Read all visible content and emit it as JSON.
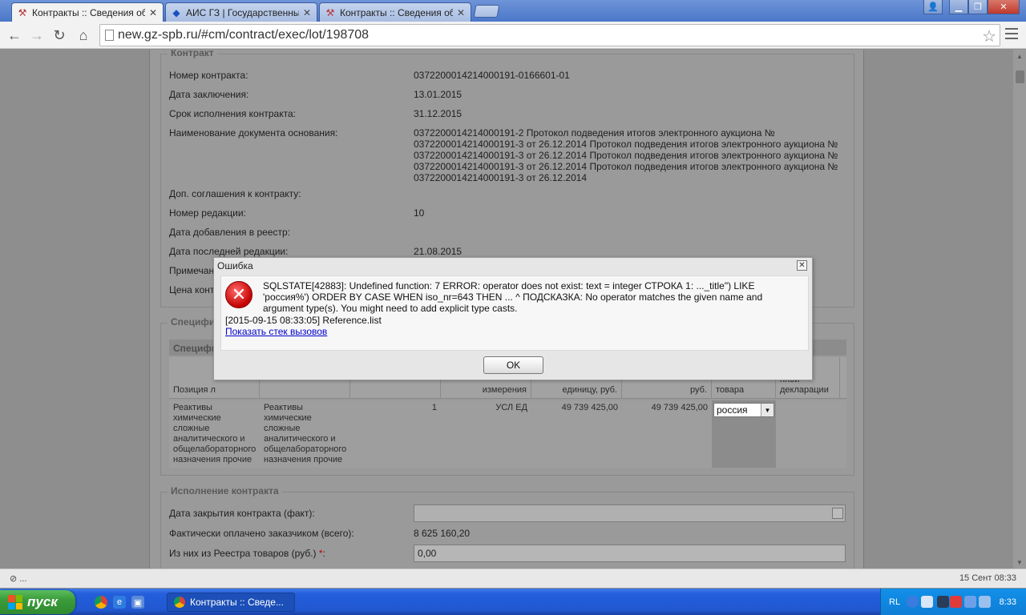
{
  "browser": {
    "tabs": [
      {
        "label": "Контракты :: Сведения об",
        "active": true
      },
      {
        "label": "АИС ГЗ | Государственный",
        "active": false
      },
      {
        "label": "Контракты :: Сведения об",
        "active": false
      }
    ],
    "url": "new.gz-spb.ru/#cm/contract/exec/lot/198708"
  },
  "contract": {
    "legend": "Контракт",
    "fields": [
      {
        "label": "Номер контракта:",
        "value": "0372200014214000191-0166601-01"
      },
      {
        "label": "Дата заключения:",
        "value": "13.01.2015"
      },
      {
        "label": "Срок исполнения контракта:",
        "value": "31.12.2015"
      },
      {
        "label": "Наименование документа основания:",
        "value": "0372200014214000191-2 Протокол подведения итогов электронного аукциона № 0372200014214000191-3 от 26.12.2014 Протокол подведения итогов электронного аукциона № 0372200014214000191-3 от 26.12.2014 Протокол подведения итогов электронного аукциона № 0372200014214000191-3 от 26.12.2014 Протокол подведения итогов электронного аукциона № 0372200014214000191-3 от 26.12.2014"
      },
      {
        "label": "Доп. соглашения к контракту:",
        "value": ""
      },
      {
        "label": "Номер редакции:",
        "value": "10"
      },
      {
        "label": "Дата добавления в реестр:",
        "value": ""
      },
      {
        "label": "Дата последней редакции:",
        "value": "21.08.2015"
      },
      {
        "label": "Примечан",
        "value": ""
      },
      {
        "label": "Цена конт",
        "value": ""
      }
    ]
  },
  "spec": {
    "legend": "Специфи",
    "title": "Специфи",
    "headers": [
      "Позиция л",
      "",
      "",
      "измерения",
      "единицу, руб.",
      "руб.",
      "товара",
      "нной декларации"
    ],
    "row": {
      "name1": "Реактивы химические сложные аналитического и общелабораторного назначения прочие",
      "name2": "Реактивы химические сложные аналитического и общелабораторного назначения прочие",
      "qty": "1",
      "unit": "УСЛ ЕД",
      "price": "49 739 425,00",
      "sum": "49 739 425,00",
      "country": "россия"
    }
  },
  "execution": {
    "legend": "Исполнение контракта",
    "close_date_label": "Дата закрытия контракта (факт):",
    "close_date_value": "",
    "paid_label": "Фактически оплачено заказчиком (всего):",
    "paid_value": "8 625 160,20",
    "registry_label": "Из них из Реестра товаров (руб.) ",
    "required_mark": "*",
    "registry_suffix": ":",
    "registry_value": "0,00"
  },
  "dialog": {
    "title": "Ошибка",
    "message": "SQLSTATE[42883]: Undefined function: 7 ERROR: operator does not exist: text = integer СТРОКА 1: ..._title\") LIKE 'россия%') ORDER BY CASE WHEN iso_nr=643 THEN ... ^ ПОДСКАЗКА: No operator matches the given name and argument type(s). You might need to add explicit type casts.",
    "timestamp": "[2015-09-15 08:33:05] Reference.list",
    "stack_link": "Показать стек вызовов",
    "ok": "OK"
  },
  "statusbar": {
    "left": "⊘ ...",
    "right": "15 Сент 08:33"
  },
  "taskbar": {
    "start": "пуск",
    "task": "Контракты :: Сведе...",
    "lang": "RL",
    "clock": "8:33"
  }
}
